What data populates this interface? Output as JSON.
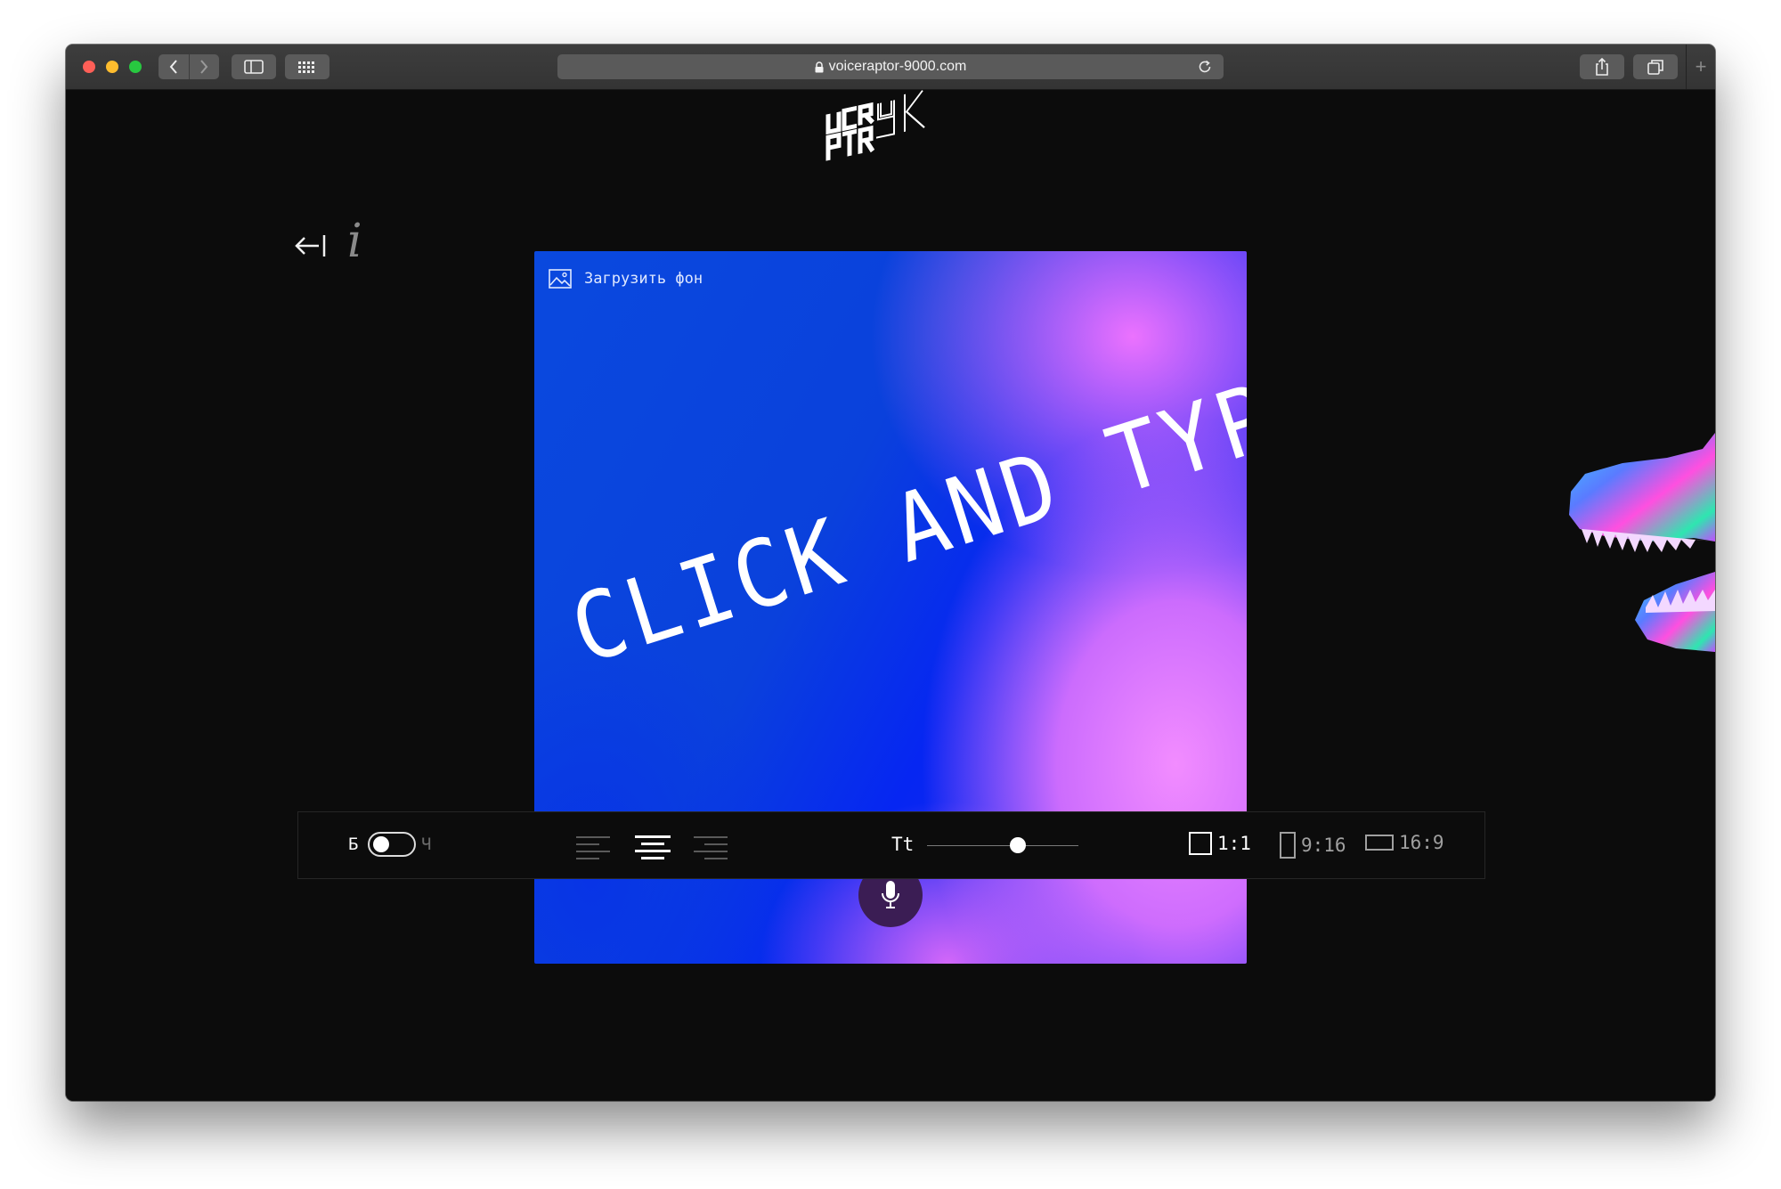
{
  "browser": {
    "url": "voiceraptor-9000.com",
    "new_tab_label": "+"
  },
  "sidebar": {
    "info_label": "i"
  },
  "canvas": {
    "upload_label": "Загрузить фон",
    "headline": "CLICK AND TYPE",
    "colors": {
      "blue": "#0a41dc",
      "pink": "#f08cff",
      "mic_bg": "#3b1d54"
    }
  },
  "toolbar": {
    "theme_left": "Б",
    "theme_right": "Ч",
    "font_size_label": "Tt",
    "font_size_level": 0.6,
    "alignment_selected": "center",
    "ratios": [
      {
        "label": "1:1",
        "active": true
      },
      {
        "label": "9:16",
        "active": false
      },
      {
        "label": "16:9",
        "active": false
      }
    ]
  }
}
